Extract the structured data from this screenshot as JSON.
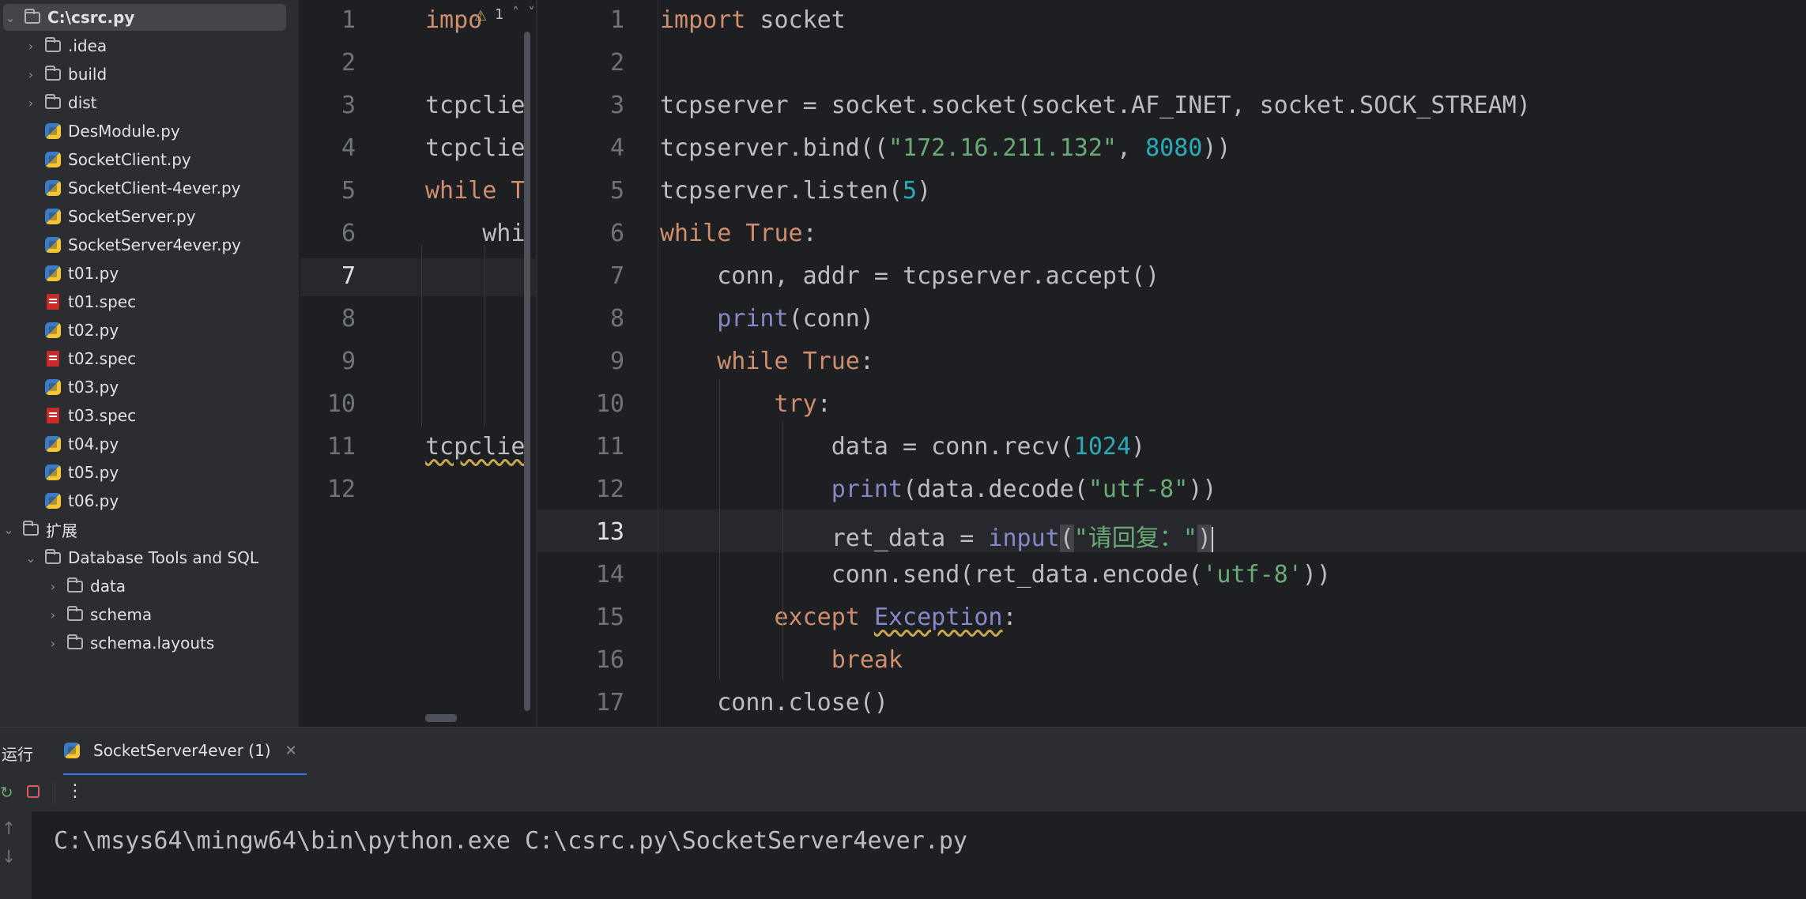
{
  "project_tree": {
    "root": {
      "label": "C:\\csrc.py"
    },
    "items": [
      {
        "label": ".idea",
        "type": "folder"
      },
      {
        "label": "build",
        "type": "folder"
      },
      {
        "label": "dist",
        "type": "folder"
      },
      {
        "label": "DesModule.py",
        "type": "python"
      },
      {
        "label": "SocketClient.py",
        "type": "python"
      },
      {
        "label": "SocketClient-4ever.py",
        "type": "python"
      },
      {
        "label": "SocketServer.py",
        "type": "python"
      },
      {
        "label": "SocketServer4ever.py",
        "type": "python"
      },
      {
        "label": "t01.py",
        "type": "python"
      },
      {
        "label": "t01.spec",
        "type": "spec"
      },
      {
        "label": "t02.py",
        "type": "python"
      },
      {
        "label": "t02.spec",
        "type": "spec"
      },
      {
        "label": "t03.py",
        "type": "python"
      },
      {
        "label": "t03.spec",
        "type": "spec"
      },
      {
        "label": "t04.py",
        "type": "python"
      },
      {
        "label": "t05.py",
        "type": "python"
      },
      {
        "label": "t06.py",
        "type": "python"
      }
    ],
    "extensions": {
      "label": "扩展",
      "db_tools": {
        "label": "Database Tools and SQL"
      },
      "children": [
        {
          "label": "data"
        },
        {
          "label": "schema"
        },
        {
          "label": "schema.layouts"
        }
      ]
    }
  },
  "editor_left": {
    "inspection_count": "1",
    "line_numbers": [
      "1",
      "2",
      "3",
      "4",
      "5",
      "6",
      "7",
      "8",
      "9",
      "10",
      "11",
      "12"
    ],
    "lines": [
      "impo",
      "",
      "tcpclie",
      "tcpclie",
      "while T",
      "    whi",
      "",
      "",
      "",
      "",
      "tcpclie",
      ""
    ]
  },
  "editor_right": {
    "line_numbers": [
      "1",
      "2",
      "3",
      "4",
      "5",
      "6",
      "7",
      "8",
      "9",
      "10",
      "11",
      "12",
      "13",
      "14",
      "15",
      "16",
      "17"
    ],
    "current_line": "13"
  },
  "run_panel": {
    "title": "运行",
    "tab_label": "SocketServer4ever (1)",
    "output": "C:\\msys64\\mingw64\\bin\\python.exe C:\\csrc.py\\SocketServer4ever.py"
  },
  "colors": {
    "keyword": "#cf8e6d",
    "string": "#6aab73",
    "number": "#2aacb8",
    "builtin": "#8888c6",
    "background": "#1e1f22",
    "panel": "#2b2d30"
  }
}
